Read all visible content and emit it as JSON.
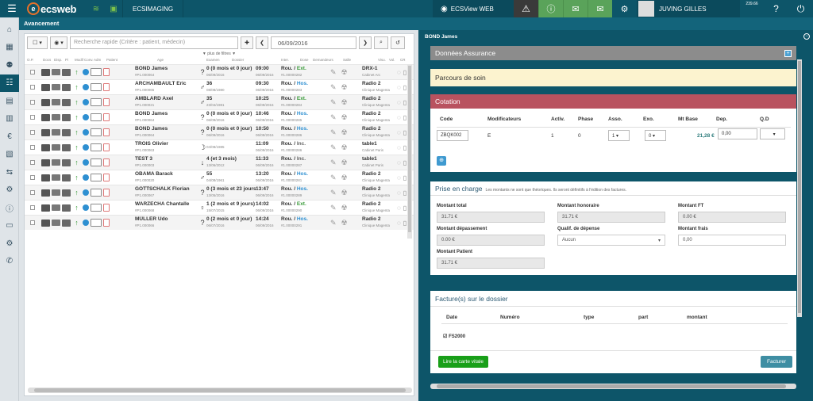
{
  "topbar": {
    "logo_text": "ecsweb",
    "site": "ECSIMAGING",
    "view_label": "ECSView WEB",
    "user": "JUVING GILLES",
    "time": "239.66"
  },
  "subbar": {
    "title": "Avancement"
  },
  "list": {
    "search_placeholder": "Recherche rapide (Critère : patient, médecin)",
    "date": "06/09/2016",
    "more_filters": "▼ plus de filtres ▼",
    "columns": [
      "O.P.",
      "Docs",
      "Disp.",
      "Pi",
      "Modif",
      "Conv.",
      "Adm",
      "Patient",
      "Age",
      "Examen",
      "Dossier",
      "Inter.",
      "Dose",
      "Demandeurs",
      "Salle",
      "Visu.",
      "Vol.",
      "CR"
    ],
    "rows": [
      {
        "name": "BOND James",
        "id": "#P1.000064",
        "gender": "?",
        "age": "0 (0 mois et 0 jour)",
        "dob": "06/09/2016",
        "hour": "09:00",
        "exdate": "06/09/2016",
        "status_a": "Rou. / ",
        "status_b": "Ext.",
        "kind": "ext",
        "num": "#1.00000282",
        "salle": "DRX-1",
        "lieu": "Cabinet Arc"
      },
      {
        "name": "ARCHAMBAULT Eric",
        "id": "#P1.000065",
        "gender": "♂",
        "age": "36",
        "dob": "08/08/1980",
        "hour": "09:30",
        "exdate": "06/09/2016",
        "status_a": "Rou. / ",
        "status_b": "Hos.",
        "kind": "hos",
        "num": "#1.00000283",
        "salle": "Radio 2",
        "lieu": "Clinique Magenta"
      },
      {
        "name": "AMBLARD Axel",
        "id": "#P1.000021",
        "gender": "♂",
        "age": "35",
        "dob": "23/04/1981",
        "hour": "10:25",
        "exdate": "06/09/2016",
        "status_a": "Rou. / ",
        "status_b": "Ext.",
        "kind": "ext",
        "num": "#1.00000284",
        "salle": "Radio 2",
        "lieu": "Clinique Magenta"
      },
      {
        "name": "BOND James",
        "id": "#P1.000064",
        "gender": "?",
        "age": "0 (0 mois et 0 jour)",
        "dob": "06/09/2016",
        "hour": "10:46",
        "exdate": "06/09/2016",
        "status_a": "Rou. / ",
        "status_b": "Hos.",
        "kind": "hos",
        "num": "#1.00000285",
        "salle": "Radio 2",
        "lieu": "Clinique Magenta"
      },
      {
        "name": "BOND James",
        "id": "#P1.000064",
        "gender": "?",
        "age": "0 (0 mois et 0 jour)",
        "dob": "06/09/2016",
        "hour": "10:50",
        "exdate": "06/09/2016",
        "status_a": "Rou. / ",
        "status_b": "Hos.",
        "kind": "hos",
        "num": "#1.00000286",
        "salle": "Radio 2",
        "lieu": "Clinique Magenta"
      },
      {
        "name": "TROIS Olivier",
        "id": "#P1.000063",
        "gender": "☽",
        "age": "",
        "dob": "04/08/1985",
        "hour": "11:09",
        "exdate": "06/09/2016",
        "status_a": "Rou. / ",
        "status_b": "Inc.",
        "kind": "inc",
        "num": "#1.00000286",
        "salle": "table1",
        "lieu": "Cabinet Paris"
      },
      {
        "name": "TEST 3",
        "id": "#P1.000003",
        "gender": "↓",
        "age": "4 (et 3 mois)",
        "dob": "13/06/2012",
        "hour": "11:33",
        "exdate": "06/09/2016",
        "status_a": "Rou. / ",
        "status_b": "Inc.",
        "kind": "inc",
        "num": "#1.00000287",
        "salle": "table1",
        "lieu": "Cabinet Paris"
      },
      {
        "name": "OBAMA Barack",
        "id": "#P1.000020",
        "gender": "♂",
        "age": "55",
        "dob": "04/08/1961",
        "hour": "13:20",
        "exdate": "06/09/2016",
        "status_a": "Rou. / ",
        "status_b": "Hos.",
        "kind": "hos",
        "num": "#1.00000281",
        "salle": "Radio 2",
        "lieu": "Clinique Magenta"
      },
      {
        "name": "GOTTSCHALK Florian",
        "id": "#P1.000067",
        "gender": "?",
        "age": "0 (3 mois et 23 jours)",
        "dob": "13/05/2016",
        "hour": "13:47",
        "exdate": "06/09/2016",
        "status_a": "Rou. / ",
        "status_b": "Hos.",
        "kind": "hos",
        "num": "#1.00000289",
        "salle": "Radio 2",
        "lieu": "Clinique Magenta"
      },
      {
        "name": "WARZECHA Chantalle",
        "id": "#P1.000068",
        "gender": "♀",
        "age": "1 (2 mois et 9 jours)",
        "dob": "15/07/2015",
        "hour": "14:02",
        "exdate": "06/09/2016",
        "status_a": "Rou. / ",
        "status_b": "Ext.",
        "kind": "ext",
        "num": "#1.00000290",
        "salle": "Radio 2",
        "lieu": "Clinique Magenta"
      },
      {
        "name": "MÜLLER Udo",
        "id": "#P1.000066",
        "gender": "?",
        "age": "0 (2 mois et 0 jour)",
        "dob": "06/07/2016",
        "hour": "14:24",
        "exdate": "06/09/2016",
        "status_a": "Rou. / ",
        "status_b": "Hos.",
        "kind": "hos",
        "num": "#1.00000291",
        "salle": "Radio 2",
        "lieu": "Clinique Magenta"
      }
    ]
  },
  "right": {
    "patient_title": "BOND James",
    "assurance": "Données Assurance",
    "parcours": "Parcours de soin",
    "cotation": {
      "title": "Cotation",
      "headers": [
        "Code",
        "Modificateurs",
        "Activ.",
        "Phase",
        "Asso.",
        "Exo.",
        "Mt Base",
        "Dep.",
        "Q.D"
      ],
      "code": "ZBQK002",
      "modif": "E",
      "activ": "1",
      "phase": "0",
      "asso": "1",
      "exo": "0",
      "mtbase": "21,28 €",
      "dep": "0,00"
    },
    "prise": {
      "title": "Prise en charge",
      "note": "Les montants ne sont que théoriques. Ils seront définitifs à l'édition des factures.",
      "montant_total_label": "Montant total",
      "montant_total": "31.71 €",
      "montant_honoraire_label": "Montant honoraire",
      "montant_honoraire": "31.71 €",
      "montant_ft_label": "Montant FT",
      "montant_ft": "0.00 €",
      "depassement_label": "Montant dépassement",
      "depassement": "0.00 €",
      "qualif_label": "Qualif. de dépense",
      "qualif": "Aucun",
      "frais_label": "Montant frais",
      "frais": "0,00",
      "patient_label": "Montant Patient",
      "patient": "31.71 €"
    },
    "factures": {
      "title": "Facture(s) sur le dossier",
      "headers": [
        "Date",
        "Numéro",
        "type",
        "part",
        "montant"
      ],
      "item": "FS2000",
      "carte_btn": "Lire la carte vitale",
      "facturer_btn": "Facturer"
    }
  }
}
